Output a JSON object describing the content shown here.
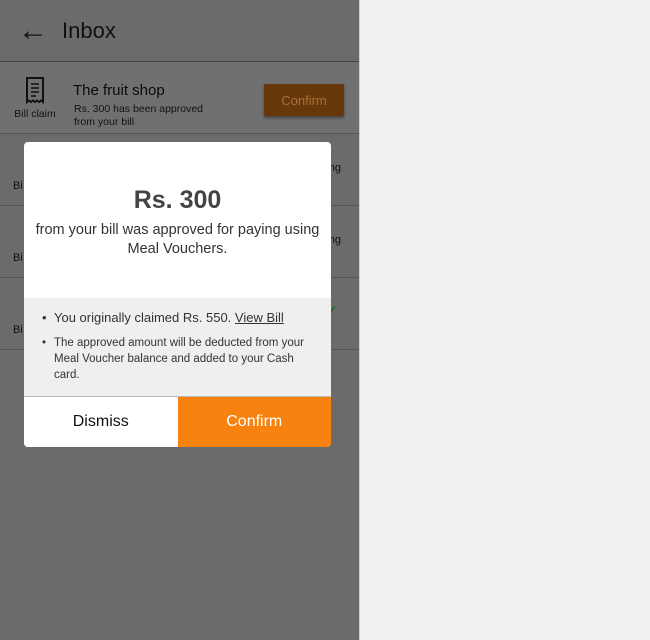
{
  "header": {
    "title": "Inbox"
  },
  "rows": [
    {
      "label": "Bill claim",
      "shop": "The fruit shop",
      "message": "Rs. 300 has been approved from your bill",
      "button": "Confirm"
    },
    {
      "label": "Bi",
      "side": "ng"
    },
    {
      "label": "Bi",
      "side": "ng"
    },
    {
      "label": "Bi"
    }
  ],
  "modal": {
    "amount": "Rs. 300",
    "description": "from your bill was approved for paying using Meal Vouchers.",
    "info1": "You originally claimed Rs. 550.",
    "info1_link": "View Bill",
    "info2": "The approved amount will be deducted from your Meal Voucher balance and added to your Cash card.",
    "dismiss": "Dismiss",
    "confirm": "Confirm"
  },
  "colors": {
    "accent": "#f7820f",
    "success": "#2a9a3a"
  }
}
